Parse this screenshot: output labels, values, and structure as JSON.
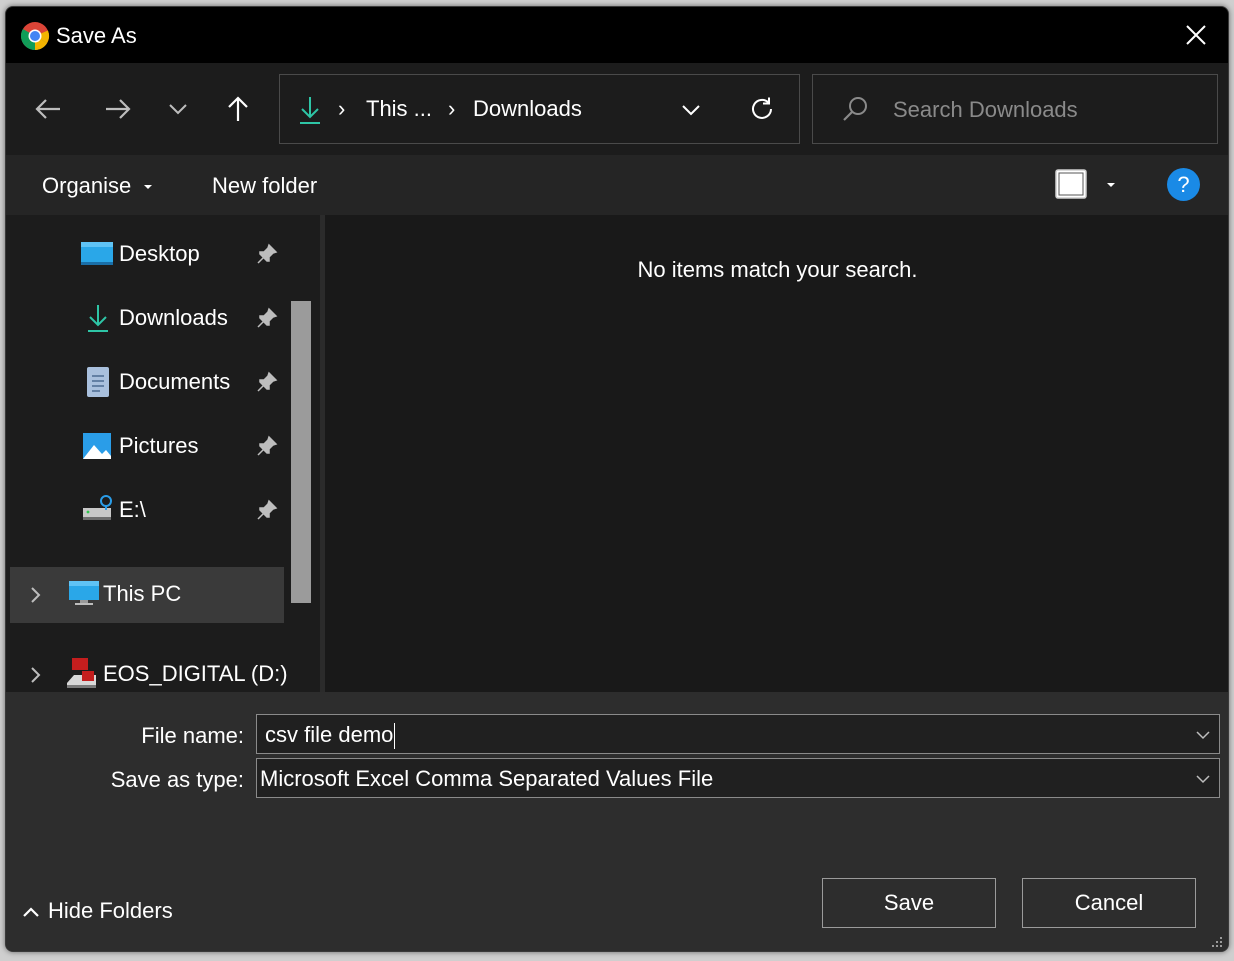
{
  "window": {
    "title": "Save As",
    "app_icon": "chrome-logo-icon"
  },
  "nav": {
    "back_icon": "arrow-left-icon",
    "forward_icon": "arrow-right-icon",
    "recent_icon": "chevron-down-icon",
    "up_icon": "arrow-up-icon"
  },
  "address": {
    "crumb_1": "This ...",
    "crumb_2": "Downloads",
    "separator": "›",
    "location_icon": "download-arrow-icon",
    "accent_color": "#2ec5a6"
  },
  "search": {
    "placeholder": "Search Downloads"
  },
  "commands": {
    "organise": "Organise",
    "new_folder": "New folder",
    "help": "?"
  },
  "sidebar": {
    "items": [
      {
        "label": "Desktop",
        "icon": "desktop-icon",
        "pinned": true
      },
      {
        "label": "Downloads",
        "icon": "download-icon",
        "pinned": true
      },
      {
        "label": "Documents",
        "icon": "documents-icon",
        "pinned": true
      },
      {
        "label": "Pictures",
        "icon": "pictures-icon",
        "pinned": true
      },
      {
        "label": "E:\\",
        "icon": "network-drive-icon",
        "pinned": true
      },
      {
        "label": "This PC",
        "icon": "computer-icon",
        "selected": true
      },
      {
        "label": "EOS_DIGITAL (D:)",
        "icon": "sd-card-icon"
      }
    ]
  },
  "main": {
    "empty_message": "No items match your search."
  },
  "form": {
    "file_name_label": "File name:",
    "file_name_value": "csv file demo",
    "save_type_label": "Save as type:",
    "save_type_value": "Microsoft Excel Comma Separated Values File"
  },
  "buttons": {
    "save": "Save",
    "cancel": "Cancel",
    "hide_folders": "Hide Folders"
  }
}
